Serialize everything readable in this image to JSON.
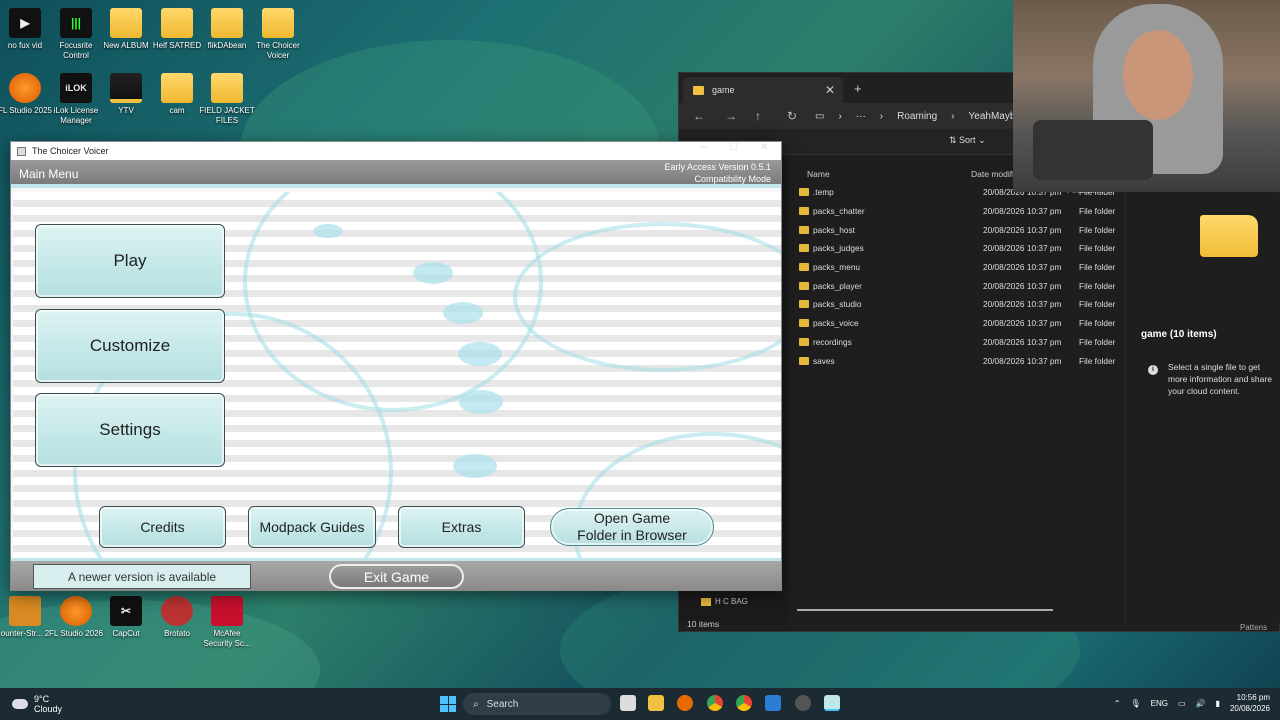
{
  "desktop": {
    "icons_top": [
      {
        "label": "no fux vid",
        "kind": "app-dark"
      },
      {
        "label": "Focusrite Control",
        "kind": "app-dark"
      },
      {
        "label": "New ALBUM",
        "kind": "folder"
      },
      {
        "label": "Helf SATRED",
        "kind": "folder"
      },
      {
        "label": "flikDAbean",
        "kind": "folder"
      },
      {
        "label": "The Choicer Voicer",
        "kind": "folder"
      }
    ],
    "icons_second": [
      {
        "label": "FL Studio 2025",
        "kind": "app"
      },
      {
        "label": "iLok License Manager",
        "kind": "app-dark"
      },
      {
        "label": "YTV",
        "kind": "folder"
      },
      {
        "label": "cam",
        "kind": "folder"
      },
      {
        "label": "FIELD JACKET FILES",
        "kind": "folder"
      }
    ],
    "icons_bottom": [
      {
        "label": "ounter-Str... 2",
        "kind": "app"
      },
      {
        "label": "FL Studio 2026",
        "kind": "app"
      },
      {
        "label": "CapCut",
        "kind": "app-dark"
      },
      {
        "label": "Brotato",
        "kind": "app"
      },
      {
        "label": "McAfee Security Sc...",
        "kind": "app"
      }
    ],
    "glyph_labels": {
      "no_fux": "▶",
      "focusrite": "|||",
      "ilok": "iLOK",
      "capcut": "✂"
    }
  },
  "game_window": {
    "title": "The Choicer Voicer",
    "header_label": "Main Menu",
    "version_line1": "Early Access Version 0.5.1",
    "version_line2": "Compatibility Mode",
    "buttons": {
      "play": "Play",
      "customize": "Customize",
      "settings": "Settings",
      "credits": "Credits",
      "modpack_guides": "Modpack Guides",
      "extras": "Extras",
      "open_folder_line1": "Open Game",
      "open_folder_line2": "Folder in Browser",
      "exit": "Exit Game"
    },
    "newer_version": "A newer version is available"
  },
  "explorer": {
    "tab_title": "game",
    "breadcrumb": [
      "···",
      "Roaming",
      "YeahMaybe"
    ],
    "sort_label": "Sort",
    "columns": {
      "name": "Name",
      "date": "Date modifi",
      "type": "File folder"
    },
    "files": [
      {
        "name": ".temp",
        "date": "20/08/2026 10:37 pm",
        "type": "File folder"
      },
      {
        "name": "packs_chatter",
        "date": "20/08/2026 10:37 pm",
        "type": "File folder"
      },
      {
        "name": "packs_host",
        "date": "20/08/2026 10:37 pm",
        "type": "File folder"
      },
      {
        "name": "packs_judges",
        "date": "20/08/2026 10:37 pm",
        "type": "File folder"
      },
      {
        "name": "packs_menu",
        "date": "20/08/2026 10:37 pm",
        "type": "File folder"
      },
      {
        "name": "packs_player",
        "date": "20/08/2026 10:37 pm",
        "type": "File folder"
      },
      {
        "name": "packs_studio",
        "date": "20/08/2026 10:37 pm",
        "type": "File folder"
      },
      {
        "name": "packs_voice",
        "date": "20/08/2026 10:37 pm",
        "type": "File folder"
      },
      {
        "name": "recordings",
        "date": "20/08/2026 10:37 pm",
        "type": "File folder"
      },
      {
        "name": "saves",
        "date": "20/08/2026 10:37 pm",
        "type": "File folder"
      }
    ],
    "left_pane_item": "H C BAG",
    "item_count": "10 items",
    "details_title": "game (10 items)",
    "details_info": "Select a single file to get more information and share your cloud content.",
    "partial_label": "Pattens"
  },
  "taskbar": {
    "temperature": "9°C",
    "weather": "Cloudy",
    "search_placeholder": "Search",
    "language": "ENG",
    "time": "10:56 pm",
    "date": "20/08/2026"
  }
}
